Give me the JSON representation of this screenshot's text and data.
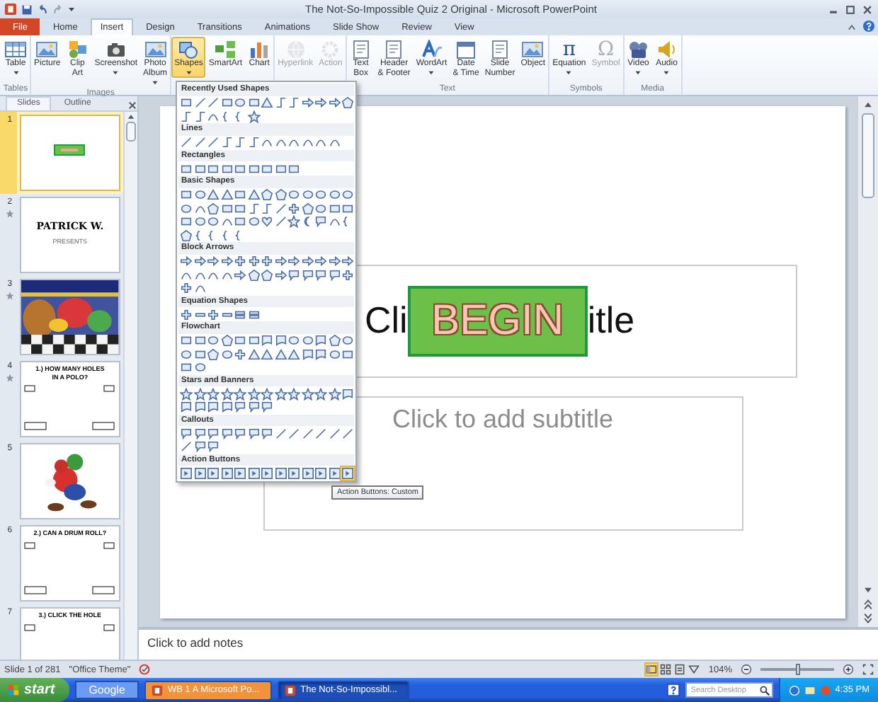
{
  "window": {
    "title": "The Not-So-Impossible Quiz 2 Original - Microsoft PowerPoint"
  },
  "tabs": [
    {
      "label": "File",
      "kind": "file",
      "selected": false
    },
    {
      "label": "Home",
      "kind": "tab",
      "selected": false
    },
    {
      "label": "Insert",
      "kind": "tab",
      "selected": true
    },
    {
      "label": "Design",
      "kind": "tab",
      "selected": false
    },
    {
      "label": "Transitions",
      "kind": "tab",
      "selected": false
    },
    {
      "label": "Animations",
      "kind": "tab",
      "selected": false
    },
    {
      "label": "Slide Show",
      "kind": "tab",
      "selected": false
    },
    {
      "label": "Review",
      "kind": "tab",
      "selected": false
    },
    {
      "label": "View",
      "kind": "tab",
      "selected": false
    }
  ],
  "ribbon": {
    "groups": [
      {
        "label": "Tables",
        "buttons": [
          {
            "label": "Table",
            "dropdown": true,
            "disabled": false,
            "open": false
          }
        ]
      },
      {
        "label": "Images",
        "buttons": [
          {
            "label": "Picture",
            "dropdown": false,
            "disabled": false,
            "open": false
          },
          {
            "label": "Clip\nArt",
            "dropdown": false,
            "disabled": false,
            "open": false
          },
          {
            "label": "Screenshot",
            "dropdown": true,
            "disabled": false,
            "open": false
          },
          {
            "label": "Photo\nAlbum",
            "dropdown": true,
            "disabled": false,
            "open": false
          }
        ]
      },
      {
        "buttons": [
          {
            "label": "Shapes",
            "dropdown": true,
            "disabled": false,
            "open": true
          },
          {
            "label": "SmartArt",
            "dropdown": false,
            "disabled": false,
            "open": false
          },
          {
            "label": "Chart",
            "dropdown": false,
            "disabled": false,
            "open": false
          }
        ]
      },
      {
        "buttons": [
          {
            "label": "Hyperlink",
            "dropdown": false,
            "disabled": true,
            "open": false
          },
          {
            "label": "Action",
            "dropdown": false,
            "disabled": true,
            "open": false
          }
        ]
      },
      {
        "label": "Text",
        "buttons": [
          {
            "label": "Text\nBox",
            "dropdown": false,
            "disabled": false,
            "open": false
          },
          {
            "label": "Header\n& Footer",
            "dropdown": false,
            "disabled": false,
            "open": false
          },
          {
            "label": "WordArt",
            "dropdown": true,
            "disabled": false,
            "open": false
          },
          {
            "label": "Date\n& Time",
            "dropdown": false,
            "disabled": false,
            "open": false
          },
          {
            "label": "Slide\nNumber",
            "dropdown": false,
            "disabled": false,
            "open": false
          },
          {
            "label": "Object",
            "dropdown": false,
            "disabled": false,
            "open": false
          }
        ]
      },
      {
        "label": "Symbols",
        "buttons": [
          {
            "label": "Equation",
            "glyph": "π",
            "dropdown": true,
            "disabled": false,
            "open": false
          },
          {
            "label": "Symbol",
            "glyph": "Ω",
            "dropdown": false,
            "disabled": true,
            "open": false
          }
        ]
      },
      {
        "label": "Media",
        "buttons": [
          {
            "label": "Video",
            "dropdown": true,
            "disabled": false,
            "open": false
          },
          {
            "label": "Audio",
            "dropdown": true,
            "disabled": false,
            "open": false
          }
        ]
      }
    ]
  },
  "slides_panel": {
    "tabs": [
      {
        "label": "Slides",
        "selected": true
      },
      {
        "label": "Outline",
        "selected": false
      }
    ],
    "slides": [
      {
        "number": "1",
        "kind": "begin",
        "selected": true,
        "animated": false
      },
      {
        "number": "2",
        "kind": "title",
        "title": "PATRICK W.",
        "subtitle": "PRESENTS",
        "selected": false,
        "animated": true
      },
      {
        "number": "3",
        "kind": "picture",
        "selected": false,
        "animated": true
      },
      {
        "number": "4",
        "kind": "question",
        "title": "1.) HOW MANY HOLES IN A POLO?",
        "bottom_boxes": true,
        "selected": false,
        "animated": true
      },
      {
        "number": "5",
        "kind": "figure",
        "selected": false,
        "animated": false
      },
      {
        "number": "6",
        "kind": "question",
        "title": "2.) CAN A DRUM ROLL?",
        "bottom_boxes": true,
        "selected": false,
        "animated": false
      },
      {
        "number": "7",
        "kind": "question",
        "title": "3.) CLICK THE HOLE",
        "selected": false,
        "animated": false
      }
    ]
  },
  "slide": {
    "title_visible": [
      "Cli",
      "itle"
    ],
    "button": "BEGIN",
    "subtitle_placeholder": "Click to add subtitle"
  },
  "notes": {
    "placeholder": "Click to add notes"
  },
  "shapes_menu": {
    "sections": [
      {
        "title": "Recently Used Shapes",
        "shapes": [
          {
            "kind": "rectangle"
          },
          {
            "kind": "line"
          },
          {
            "kind": "line"
          },
          {
            "kind": "rectangle"
          },
          {
            "kind": "oval"
          },
          {
            "kind": "rectangle"
          },
          {
            "kind": "triangle"
          },
          {
            "kind": "elbow"
          },
          {
            "kind": "elbow"
          },
          {
            "kind": "arrow"
          },
          {
            "kind": "arrow"
          },
          {
            "kind": "arrow"
          },
          {
            "kind": "pentagon"
          },
          {
            "kind": "elbow"
          },
          {
            "kind": "elbow"
          },
          {
            "kind": "curve"
          },
          {
            "kind": "brace"
          },
          {
            "kind": "brace"
          },
          {
            "kind": "star"
          }
        ]
      },
      {
        "title": "Lines",
        "shapes": [
          {
            "kind": "line"
          },
          {
            "kind": "line"
          },
          {
            "kind": "line"
          },
          {
            "kind": "elbow"
          },
          {
            "kind": "elbow"
          },
          {
            "kind": "elbow"
          },
          {
            "kind": "curve"
          },
          {
            "kind": "curve"
          },
          {
            "kind": "curve"
          },
          {
            "kind": "curve"
          },
          {
            "kind": "curve"
          },
          {
            "kind": "curve"
          }
        ]
      },
      {
        "title": "Rectangles",
        "shapes": [
          {
            "kind": "rectangle"
          },
          {
            "kind": "rectangle"
          },
          {
            "kind": "rectangle"
          },
          {
            "kind": "rectangle"
          },
          {
            "kind": "rectangle"
          },
          {
            "kind": "rectangle"
          },
          {
            "kind": "rectangle"
          },
          {
            "kind": "rectangle"
          },
          {
            "kind": "rectangle"
          }
        ]
      },
      {
        "title": "Basic Shapes",
        "shapes": [
          {
            "kind": "rectangle"
          },
          {
            "kind": "oval"
          },
          {
            "kind": "triangle"
          },
          {
            "kind": "triangle"
          },
          {
            "kind": "rectangle"
          },
          {
            "kind": "triangle"
          },
          {
            "kind": "pentagon"
          },
          {
            "kind": "pentagon"
          },
          {
            "kind": "oval"
          },
          {
            "kind": "oval"
          },
          {
            "kind": "oval"
          },
          {
            "kind": "oval"
          },
          {
            "kind": "oval"
          },
          {
            "kind": "oval"
          },
          {
            "kind": "curve"
          },
          {
            "kind": "pentagon"
          },
          {
            "kind": "rectangle"
          },
          {
            "kind": "rectangle"
          },
          {
            "kind": "elbow"
          },
          {
            "kind": "elbow"
          },
          {
            "kind": "line"
          },
          {
            "kind": "cross"
          },
          {
            "kind": "pentagon"
          },
          {
            "kind": "oval"
          },
          {
            "kind": "rectangle"
          },
          {
            "kind": "rectangle"
          },
          {
            "kind": "rectangle"
          },
          {
            "kind": "oval"
          },
          {
            "kind": "oval"
          },
          {
            "kind": "curve"
          },
          {
            "kind": "rectangle"
          },
          {
            "kind": "oval"
          },
          {
            "kind": "heart"
          },
          {
            "kind": "line"
          },
          {
            "kind": "star"
          },
          {
            "kind": "moon"
          },
          {
            "kind": "callout"
          },
          {
            "kind": "curve"
          },
          {
            "kind": "brace"
          },
          {
            "kind": "pentagon"
          },
          {
            "kind": "brace"
          },
          {
            "kind": "brace"
          },
          {
            "kind": "brace"
          },
          {
            "kind": "brace"
          }
        ]
      },
      {
        "title": "Block Arrows",
        "shapes": [
          {
            "kind": "arrow"
          },
          {
            "kind": "arrow"
          },
          {
            "kind": "arrow"
          },
          {
            "kind": "arrow"
          },
          {
            "kind": "cross"
          },
          {
            "kind": "cross"
          },
          {
            "kind": "cross"
          },
          {
            "kind": "arrow"
          },
          {
            "kind": "arrow"
          },
          {
            "kind": "arrow"
          },
          {
            "kind": "arrow"
          },
          {
            "kind": "arrow"
          },
          {
            "kind": "arrow"
          },
          {
            "kind": "curve"
          },
          {
            "kind": "curve"
          },
          {
            "kind": "curve"
          },
          {
            "kind": "curve"
          },
          {
            "kind": "arrow"
          },
          {
            "kind": "pentagon"
          },
          {
            "kind": "pentagon"
          },
          {
            "kind": "arrow"
          },
          {
            "kind": "callout"
          },
          {
            "kind": "callout"
          },
          {
            "kind": "callout"
          },
          {
            "kind": "callout"
          },
          {
            "kind": "cross"
          },
          {
            "kind": "cross"
          },
          {
            "kind": "curve"
          }
        ]
      },
      {
        "title": "Equation Shapes",
        "shapes": [
          {
            "kind": "cross"
          },
          {
            "kind": "minus"
          },
          {
            "kind": "cross"
          },
          {
            "kind": "minus"
          },
          {
            "kind": "equals"
          },
          {
            "kind": "equals"
          }
        ]
      },
      {
        "title": "Flowchart",
        "shapes": [
          {
            "kind": "rectangle"
          },
          {
            "kind": "rectangle"
          },
          {
            "kind": "oval"
          },
          {
            "kind": "pentagon"
          },
          {
            "kind": "rectangle"
          },
          {
            "kind": "rectangle"
          },
          {
            "kind": "document"
          },
          {
            "kind": "document"
          },
          {
            "kind": "oval"
          },
          {
            "kind": "oval"
          },
          {
            "kind": "document"
          },
          {
            "kind": "pentagon"
          },
          {
            "kind": "oval"
          },
          {
            "kind": "oval"
          },
          {
            "kind": "rectangle"
          },
          {
            "kind": "pentagon"
          },
          {
            "kind": "oval"
          },
          {
            "kind": "cross"
          },
          {
            "kind": "triangle"
          },
          {
            "kind": "triangle"
          },
          {
            "kind": "triangle"
          },
          {
            "kind": "triangle"
          },
          {
            "kind": "document"
          },
          {
            "kind": "document"
          },
          {
            "kind": "oval"
          },
          {
            "kind": "rectangle"
          },
          {
            "kind": "rectangle"
          },
          {
            "kind": "oval"
          }
        ]
      },
      {
        "title": "Stars and Banners",
        "shapes": [
          {
            "kind": "star"
          },
          {
            "kind": "star"
          },
          {
            "kind": "star"
          },
          {
            "kind": "star"
          },
          {
            "kind": "star"
          },
          {
            "kind": "star"
          },
          {
            "kind": "star"
          },
          {
            "kind": "star"
          },
          {
            "kind": "star"
          },
          {
            "kind": "star"
          },
          {
            "kind": "star"
          },
          {
            "kind": "star"
          },
          {
            "kind": "document"
          },
          {
            "kind": "document"
          },
          {
            "kind": "document"
          },
          {
            "kind": "document"
          },
          {
            "kind": "document"
          },
          {
            "kind": "callout"
          },
          {
            "kind": "callout"
          },
          {
            "kind": "callout"
          }
        ]
      },
      {
        "title": "Callouts",
        "shapes": [
          {
            "kind": "callout"
          },
          {
            "kind": "callout"
          },
          {
            "kind": "callout"
          },
          {
            "kind": "callout"
          },
          {
            "kind": "callout"
          },
          {
            "kind": "callout"
          },
          {
            "kind": "callout"
          },
          {
            "kind": "line"
          },
          {
            "kind": "line"
          },
          {
            "kind": "line"
          },
          {
            "kind": "line"
          },
          {
            "kind": "line"
          },
          {
            "kind": "line"
          },
          {
            "kind": "line"
          },
          {
            "kind": "callout"
          },
          {
            "kind": "callout"
          }
        ]
      },
      {
        "title": "Action Buttons",
        "shapes": [
          {
            "kind": "button",
            "selected": false
          },
          {
            "kind": "button",
            "selected": false
          },
          {
            "kind": "button",
            "selected": false
          },
          {
            "kind": "button",
            "selected": false
          },
          {
            "kind": "button",
            "selected": false
          },
          {
            "kind": "button",
            "selected": false
          },
          {
            "kind": "button",
            "selected": false
          },
          {
            "kind": "button",
            "selected": false
          },
          {
            "kind": "button",
            "selected": false
          },
          {
            "kind": "button",
            "selected": false
          },
          {
            "kind": "button",
            "selected": false
          },
          {
            "kind": "button",
            "selected": false
          },
          {
            "kind": "button",
            "selected": true
          }
        ]
      }
    ]
  },
  "tooltip": "Action Buttons: Custom",
  "status_bar": {
    "slide": "Slide 1 of 281",
    "theme": "\"Office Theme\"",
    "views": [
      {
        "selected": true
      },
      {
        "selected": false
      },
      {
        "selected": false
      },
      {
        "selected": false
      }
    ],
    "zoom": {
      "reading": "104%",
      "level": 0.5
    }
  },
  "taskbar": {
    "start": "start",
    "toolbar": "Google",
    "tasks": [
      {
        "label": "WB 1 A Microsoft Po...",
        "selected": false,
        "flashing": true
      },
      {
        "label": "The Not-So-Impossibl...",
        "selected": true,
        "flashing": false
      }
    ],
    "search": {
      "placeholder": "Search Desktop"
    },
    "clock": "4:35 PM"
  }
}
